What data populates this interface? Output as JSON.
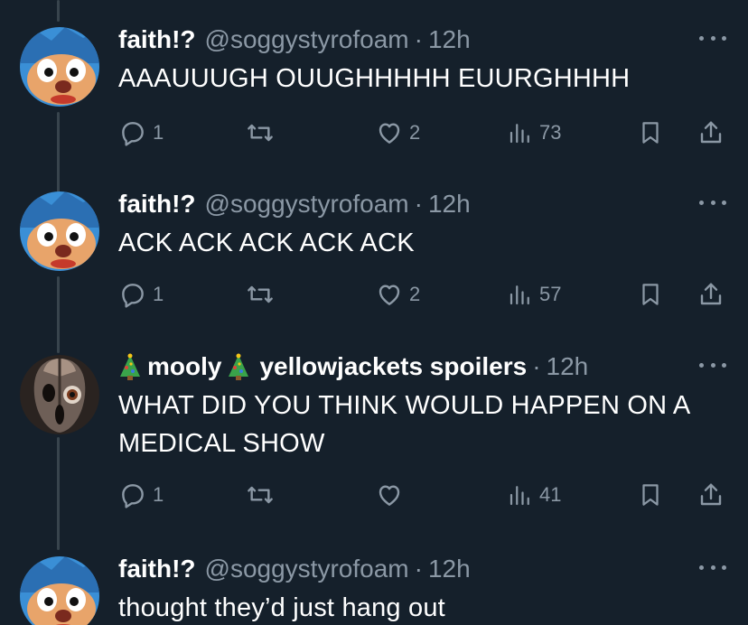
{
  "tweets": [
    {
      "display_name": "faith!?",
      "handle": "@soggystyrofoam",
      "separator": "·",
      "time": "12h",
      "text": "AAAUUUGH OUUGHHHHH EUURGHHHH",
      "replies": "1",
      "retweets": "",
      "likes": "2",
      "views": "73",
      "avatar": "blue-hedgehog-avatar"
    },
    {
      "display_name": "faith!?",
      "handle": "@soggystyrofoam",
      "separator": "·",
      "time": "12h",
      "text": "ACK ACK ACK ACK ACK",
      "replies": "1",
      "retweets": "",
      "likes": "2",
      "views": "57",
      "avatar": "blue-hedgehog-avatar"
    },
    {
      "display_name_prefix_emoji": "christmas-tree-emoji",
      "display_name": "mooly",
      "display_name_suffix_emoji": "christmas-tree-emoji",
      "handle": "yellowjackets spoilers",
      "separator": "·",
      "time": "12h",
      "text": "WHAT DID YOU THINK WOULD HAPPEN ON A MEDICAL SHOW",
      "replies": "1",
      "retweets": "",
      "likes": "",
      "views": "41",
      "avatar": "ghostface-mask-avatar"
    },
    {
      "display_name": "faith!?",
      "handle": "@soggystyrofoam",
      "separator": "·",
      "time": "12h",
      "text": "thought they’d just hang out",
      "avatar": "blue-hedgehog-avatar"
    }
  ],
  "colors": {
    "background": "#15202b",
    "text": "#ffffff",
    "secondary": "#8b98a5",
    "thread_line": "#38444d"
  }
}
